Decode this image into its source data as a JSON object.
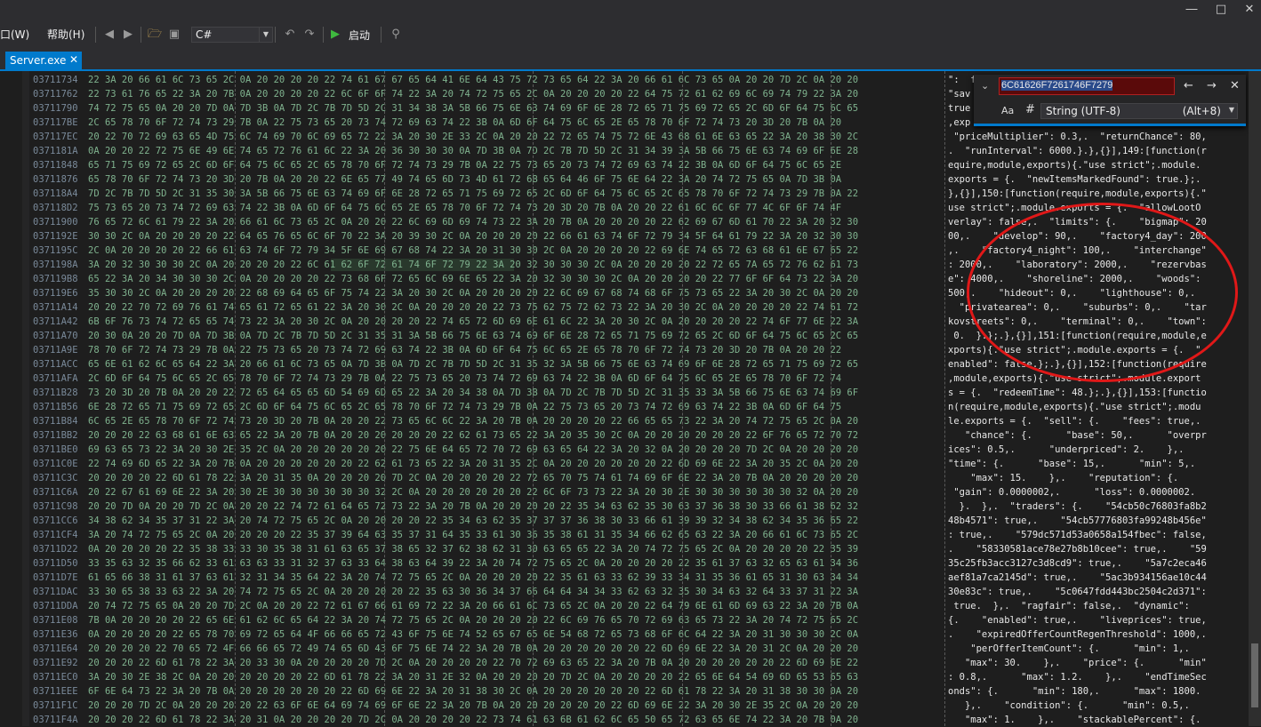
{
  "window": {
    "minimize": "―",
    "maximize": "□",
    "close": "✕"
  },
  "menu": {
    "window_label": "口(W)",
    "help_label": "帮助(H)"
  },
  "toolbar": {
    "language": "C#",
    "start_label": "启动"
  },
  "tab": {
    "title": "Server.exe",
    "close": "✕"
  },
  "find": {
    "query": "6C61626F7261746F7279",
    "match_case": "Aa",
    "hash_symbol": "#",
    "encoding": "String (UTF-8)",
    "encoding_shortcut": "(Alt+8)"
  },
  "rows": [
    {
      "addr": "03711734",
      "hex": "22 3A 20 66 61 6C 73 65 2C 0A 20 20 20 20 22 74 61 67 67 65 64 41 6E 64 43 75 72 73 65 64 22 3A 20 66 61 6C 73 65 0A 20 20 7D 2C 0A 20 20",
      "text": "\":  f"
    },
    {
      "addr": "03711762",
      "hex": "22 73 61 76 65 22 3A 20 7B 0A 20 20 20 20 22 6C 6F 6F 74 22 3A 20 74 72 75 65 2C 0A 20 20 20 20 22 64 75 72 61 62 69 6C 69 74 79 22 3A 20",
      "text": "\"sav"
    },
    {
      "addr": "03711790",
      "hex": "74 72 75 65 0A 20 20 7D 0A 7D 3B 0A 7D 2C 7B 7D 5D 2C 31 34 38 3A 5B 66 75 6E 63 74 69 6F 6E 28 72 65 71 75 69 72 65 2C 6D 6F 64 75 6C 65",
      "text": "true"
    },
    {
      "addr": "037117BE",
      "hex": "2C 65 78 70 6F 72 74 73 29 7B 0A 22 75 73 65 20 73 74 72 69 63 74 22 3B 0A 6D 6F 64 75 6C 65 2E 65 78 70 6F 72 74 73 20 3D 20 7B 0A 20",
      "text": ",exp"
    },
    {
      "addr": "037117EC",
      "hex": "20 22 70 72 69 63 65 4D 75 6C 74 69 70 6C 69 65 72 22 3A 20 30 2E 33 2C 0A 20 20 22 72 65 74 75 72 6E 43 68 61 6E 63 65 22 3A 20 38 30 2C",
      "text": " \"priceMultiplier\": 0.3,.  \"returnChance\": 80,"
    },
    {
      "addr": "0371181A",
      "hex": "0A 20 20 22 72 75 6E 49 6E 74 65 72 76 61 6C 22 3A 20 36 30 30 30 0A 7D 3B 0A 7D 2C 7B 7D 5D 2C 31 34 39 3A 5B 66 75 6E 63 74 69 6F 6E 28",
      "text": ".  \"runInterval\": 6000.}.},{}],149:[function(r"
    },
    {
      "addr": "03711848",
      "hex": "65 71 75 69 72 65 2C 6D 6F 64 75 6C 65 2C 65 78 70 6F 72 74 73 29 7B 0A 22 75 73 65 20 73 74 72 69 63 74 22 3B 0A 6D 6F 64 75 6C 65 2E",
      "text": "equire,module,exports){.\"use strict\";.module."
    },
    {
      "addr": "03711876",
      "hex": "65 78 70 6F 72 74 73 20 3D 20 7B 0A 20 20 22 6E 65 77 49 74 65 6D 73 4D 61 72 6B 65 64 46 6F 75 6E 64 22 3A 20 74 72 75 65 0A 7D 3B 0A",
      "text": "exports = {.  \"newItemsMarkedFound\": true.};."
    },
    {
      "addr": "037118A4",
      "hex": "7D 2C 7B 7D 5D 2C 31 35 30 3A 5B 66 75 6E 63 74 69 6F 6E 28 72 65 71 75 69 72 65 2C 6D 6F 64 75 6C 65 2C 65 78 70 6F 72 74 73 29 7B 0A 22",
      "text": "},{}],150:[function(require,module,exports){.\""
    },
    {
      "addr": "037118D2",
      "hex": "75 73 65 20 73 74 72 69 63 74 22 3B 0A 6D 6F 64 75 6C 65 2E 65 78 70 6F 72 74 73 20 3D 20 7B 0A 20 20 22 61 6C 6C 6F 77 4C 6F 6F 74 4F",
      "text": "use strict\";.module.exports = {.  \"allowLootO"
    },
    {
      "addr": "03711900",
      "hex": "76 65 72 6C 61 79 22 3A 20 66 61 6C 73 65 2C 0A 20 20 22 6C 69 6D 69 74 73 22 3A 20 7B 0A 20 20 20 20 22 62 69 67 6D 61 70 22 3A 20 32 30",
      "text": "verlay\": false,.  \"limits\": {.    \"bigmap\": 20"
    },
    {
      "addr": "0371192E",
      "hex": "30 30 2C 0A 20 20 20 20 22 64 65 76 65 6C 6F 70 22 3A 20 39 30 2C 0A 20 20 20 20 22 66 61 63 74 6F 72 79 34 5F 64 61 79 22 3A 20 32 30 30",
      "text": "00,.    \"develop\": 90,.    \"factory4_day\": 200"
    },
    {
      "addr": "0371195C",
      "hex": "2C 0A 20 20 20 20 22 66 61 63 74 6F 72 79 34 5F 6E 69 67 68 74 22 3A 20 31 30 30 2C 0A 20 20 20 20 22 69 6E 74 65 72 63 68 61 6E 67 65 22",
      "text": ",.    \"factory4_night\": 100,.    \"interchange\""
    },
    {
      "addr": "0371198A",
      "hex": "3A 20 32 30 30 30 2C 0A 20 20 20 20 22 6C 61 62 6F 72 61 74 6F 72 79 22 3A 20 32 30 30 30 2C 0A 20 20 20 20 22 72 65 7A 65 72 76 62 61 73",
      "text": ": 2000,.    \"laboratory\": 2000,.    \"rezervbas"
    },
    {
      "addr": "037119B8",
      "hex": "65 22 3A 20 34 30 30 30 2C 0A 20 20 20 20 22 73 68 6F 72 65 6C 69 6E 65 22 3A 20 32 30 30 30 2C 0A 20 20 20 20 22 77 6F 6F 64 73 22 3A 20",
      "text": "e\": 4000,.    \"shoreline\": 2000,.    \"woods\":"
    },
    {
      "addr": "037119E6",
      "hex": "35 30 30 2C 0A 20 20 20 20 22 68 69 64 65 6F 75 74 22 3A 20 30 2C 0A 20 20 20 20 22 6C 69 67 68 74 68 6F 75 73 65 22 3A 20 30 2C 0A 20 20",
      "text": "500,.    \"hideout\": 0,.    \"lighthouse\": 0,."
    },
    {
      "addr": "03711A14",
      "hex": "20 20 22 70 72 69 76 61 74 65 61 72 65 61 22 3A 20 30 2C 0A 20 20 20 20 22 73 75 62 75 72 62 73 22 3A 20 30 2C 0A 20 20 20 20 22 74 61 72",
      "text": "  \"privatearea\": 0,.    \"suburbs\": 0,.    \"tar"
    },
    {
      "addr": "03711A42",
      "hex": "6B 6F 76 73 74 72 65 65 74 73 22 3A 20 30 2C 0A 20 20 20 20 22 74 65 72 6D 69 6E 61 6C 22 3A 20 30 2C 0A 20 20 20 20 22 74 6F 77 6E 22 3A",
      "text": "kovstreets\": 0,.    \"terminal\": 0,.    \"town\":"
    },
    {
      "addr": "03711A70",
      "hex": "20 30 0A 20 20 7D 0A 7D 3B 0A 7D 2C 7B 7D 5D 2C 31 35 31 3A 5B 66 75 6E 63 74 69 6F 6E 28 72 65 71 75 69 72 65 2C 6D 6F 64 75 6C 65 2C 65",
      "text": " 0.  }.};.},{}],151:[function(require,module,e"
    },
    {
      "addr": "03711A9E",
      "hex": "78 70 6F 72 74 73 29 7B 0A 22 75 73 65 20 73 74 72 69 63 74 22 3B 0A 6D 6F 64 75 6C 65 2E 65 78 70 6F 72 74 73 20 3D 20 7B 0A 20 20 22",
      "text": "xports){.\"use strict\";.module.exports = {.  \""
    },
    {
      "addr": "03711ACC",
      "hex": "65 6E 61 62 6C 65 64 22 3A 20 66 61 6C 73 65 0A 7D 3B 0A 7D 2C 7B 7D 5D 2C 31 35 32 3A 5B 66 75 6E 63 74 69 6F 6E 28 72 65 71 75 69 72 65",
      "text": "enabled\": false.};.},{}],152:[function(require"
    },
    {
      "addr": "03711AFA",
      "hex": "2C 6D 6F 64 75 6C 65 2C 65 78 70 6F 72 74 73 29 7B 0A 22 75 73 65 20 73 74 72 69 63 74 22 3B 0A 6D 6F 64 75 6C 65 2E 65 78 70 6F 72 74",
      "text": ",module,exports){.\"use strict\";.module.export"
    },
    {
      "addr": "03711B28",
      "hex": "73 20 3D 20 7B 0A 20 20 22 72 65 64 65 65 6D 54 69 6D 65 22 3A 20 34 38 0A 7D 3B 0A 7D 2C 7B 7D 5D 2C 31 35 33 3A 5B 66 75 6E 63 74 69 6F",
      "text": "s = {.  \"redeemTime\": 48.};.},{}],153:[functio"
    },
    {
      "addr": "03711B56",
      "hex": "6E 28 72 65 71 75 69 72 65 2C 6D 6F 64 75 6C 65 2C 65 78 70 6F 72 74 73 29 7B 0A 22 75 73 65 20 73 74 72 69 63 74 22 3B 0A 6D 6F 64 75",
      "text": "n(require,module,exports){.\"use strict\";.modu"
    },
    {
      "addr": "03711B84",
      "hex": "6C 65 2E 65 78 70 6F 72 74 73 20 3D 20 7B 0A 20 20 22 73 65 6C 6C 22 3A 20 7B 0A 20 20 20 20 22 66 65 65 73 22 3A 20 74 72 75 65 2C 0A 20",
      "text": "le.exports = {.  \"sell\": {.    \"fees\": true,."
    },
    {
      "addr": "03711BB2",
      "hex": "20 20 20 22 63 68 61 6E 63 65 22 3A 20 7B 0A 20 20 20 20 20 20 22 62 61 73 65 22 3A 20 35 30 2C 0A 20 20 20 20 20 20 22 6F 76 65 72 70 72",
      "text": "   \"chance\": {.      \"base\": 50,.      \"overpr"
    },
    {
      "addr": "03711BE0",
      "hex": "69 63 65 73 22 3A 20 30 2E 35 2C 0A 20 20 20 20 20 20 22 75 6E 64 65 72 70 72 69 63 65 64 22 3A 20 32 0A 20 20 20 20 7D 2C 0A 20 20 20 20",
      "text": "ices\": 0.5,.      \"underpriced\": 2.    },."
    },
    {
      "addr": "03711C0E",
      "hex": "22 74 69 6D 65 22 3A 20 7B 0A 20 20 20 20 20 20 22 62 61 73 65 22 3A 20 31 35 2C 0A 20 20 20 20 20 20 22 6D 69 6E 22 3A 20 35 2C 0A 20 20",
      "text": "\"time\": {.      \"base\": 15,.      \"min\": 5,."
    },
    {
      "addr": "03711C3C",
      "hex": "20 20 20 20 22 6D 61 78 22 3A 20 31 35 0A 20 20 20 20 7D 2C 0A 20 20 20 20 22 72 65 70 75 74 61 74 69 6F 6E 22 3A 20 7B 0A 20 20 20 20 20",
      "text": "    \"max\": 15.    },.    \"reputation\": {."
    },
    {
      "addr": "03711C6A",
      "hex": "20 22 67 61 69 6E 22 3A 20 30 2E 30 30 30 30 30 30 32 2C 0A 20 20 20 20 20 20 22 6C 6F 73 73 22 3A 20 30 2E 30 30 30 30 30 30 32 0A 20 20",
      "text": " \"gain\": 0.0000002,.      \"loss\": 0.0000002."
    },
    {
      "addr": "03711C98",
      "hex": "20 20 7D 0A 20 20 7D 2C 0A 20 20 22 74 72 61 64 65 72 73 22 3A 20 7B 0A 20 20 20 20 22 35 34 63 62 35 30 63 37 36 38 30 33 66 61 38 62 32",
      "text": "  }.  },.  \"traders\": {.    \"54cb50c76803fa8b2"
    },
    {
      "addr": "03711CC6",
      "hex": "34 38 62 34 35 37 31 22 3A 20 74 72 75 65 2C 0A 20 20 20 20 22 35 34 63 62 35 37 37 37 36 38 30 33 66 61 39 39 32 34 38 62 34 35 36 65 22",
      "text": "48b4571\": true,.    \"54cb57776803fa99248b456e\""
    },
    {
      "addr": "03711CF4",
      "hex": "3A 20 74 72 75 65 2C 0A 20 20 20 20 22 35 37 39 64 63 35 37 31 64 35 33 61 30 36 35 38 61 31 35 34 66 62 65 63 22 3A 20 66 61 6C 73 65 2C",
      "text": ": true,.    \"579dc571d53a0658a154fbec\": false,"
    },
    {
      "addr": "03711D22",
      "hex": "0A 20 20 20 20 22 35 38 33 33 30 35 38 31 61 63 65 37 38 65 32 37 62 38 62 31 30 63 65 65 22 3A 20 74 72 75 65 2C 0A 20 20 20 20 22 35 39",
      "text": ".    \"58330581ace78e27b8b10cee\": true,.    \"59"
    },
    {
      "addr": "03711D50",
      "hex": "33 35 63 32 35 66 62 33 61 63 63 33 31 32 37 63 33 64 38 63 64 39 22 3A 20 74 72 75 65 2C 0A 20 20 20 20 22 35 61 37 63 32 65 63 61 34 36",
      "text": "35c25fb3acc3127c3d8cd9\": true,.    \"5a7c2eca46"
    },
    {
      "addr": "03711D7E",
      "hex": "61 65 66 38 31 61 37 63 61 32 31 34 35 64 22 3A 20 74 72 75 65 2C 0A 20 20 20 20 22 35 61 63 33 62 39 33 34 31 35 36 61 65 31 30 63 34 34",
      "text": "aef81a7ca2145d\": true,.    \"5ac3b934156ae10c44"
    },
    {
      "addr": "03711DAC",
      "hex": "33 30 65 38 33 63 22 3A 20 74 72 75 65 2C 0A 20 20 20 20 22 35 63 30 36 34 37 66 64 64 34 34 33 62 63 32 35 30 34 63 32 64 33 37 31 22 3A",
      "text": "30e83c\": true,.    \"5c0647fdd443bc2504c2d371\":"
    },
    {
      "addr": "03711DDA",
      "hex": "20 74 72 75 65 0A 20 20 7D 2C 0A 20 20 22 72 61 67 66 61 69 72 22 3A 20 66 61 6C 73 65 2C 0A 20 20 22 64 79 6E 61 6D 69 63 22 3A 20 7B 0A",
      "text": " true.  },.  \"ragfair\": false,.  \"dynamic\":"
    },
    {
      "addr": "03711E08",
      "hex": "7B 0A 20 20 20 20 22 65 6E 61 62 6C 65 64 22 3A 20 74 72 75 65 2C 0A 20 20 20 20 22 6C 69 76 65 70 72 69 63 65 73 22 3A 20 74 72 75 65 2C",
      "text": "{.    \"enabled\": true,.    \"liveprices\": true,"
    },
    {
      "addr": "03711E36",
      "hex": "0A 20 20 20 20 22 65 78 70 69 72 65 64 4F 66 66 65 72 43 6F 75 6E 74 52 65 67 65 6E 54 68 72 65 73 68 6F 6C 64 22 3A 20 31 30 30 30 2C 0A",
      "text": ".    \"expiredOfferCountRegenThreshold\": 1000,."
    },
    {
      "addr": "03711E64",
      "hex": "20 20 20 20 22 70 65 72 4F 66 66 65 72 49 74 65 6D 43 6F 75 6E 74 22 3A 20 7B 0A 20 20 20 20 20 20 22 6D 69 6E 22 3A 20 31 2C 0A 20 20 20",
      "text": "    \"perOfferItemCount\": {.      \"min\": 1,."
    },
    {
      "addr": "03711E92",
      "hex": "20 20 20 22 6D 61 78 22 3A 20 33 30 0A 20 20 20 20 7D 2C 0A 20 20 20 20 22 70 72 69 63 65 22 3A 20 7B 0A 20 20 20 20 20 20 22 6D 69 6E 22",
      "text": "   \"max\": 30.    },.    \"price\": {.      \"min\""
    },
    {
      "addr": "03711EC0",
      "hex": "3A 20 30 2E 38 2C 0A 20 20 20 20 20 20 22 6D 61 78 22 3A 20 31 2E 32 0A 20 20 20 20 7D 2C 0A 20 20 20 20 22 65 6E 64 54 69 6D 65 53 65 63",
      "text": ": 0.8,.      \"max\": 1.2.    },.    \"endTimeSec"
    },
    {
      "addr": "03711EEE",
      "hex": "6F 6E 64 73 22 3A 20 7B 0A 20 20 20 20 20 20 22 6D 69 6E 22 3A 20 31 38 30 2C 0A 20 20 20 20 20 20 22 6D 61 78 22 3A 20 31 38 30 30 0A 20",
      "text": "onds\": {.      \"min\": 180,.      \"max\": 1800."
    },
    {
      "addr": "03711F1C",
      "hex": "20 20 20 7D 2C 0A 20 20 20 20 22 63 6F 6E 64 69 74 69 6F 6E 22 3A 20 7B 0A 20 20 20 20 20 20 22 6D 69 6E 22 3A 20 30 2E 35 2C 0A 20 20 20",
      "text": "   },.    \"condition\": {.      \"min\": 0.5,."
    },
    {
      "addr": "03711F4A",
      "hex": "20 20 20 22 6D 61 78 22 3A 20 31 0A 20 20 20 20 7D 2C 0A 20 20 20 20 22 73 74 61 63 6B 61 62 6C 65 50 65 72 63 65 6E 74 22 3A 20 7B 0A 20",
      "text": "   \"max\": 1.    },.    \"stackablePercent\": {."
    }
  ]
}
